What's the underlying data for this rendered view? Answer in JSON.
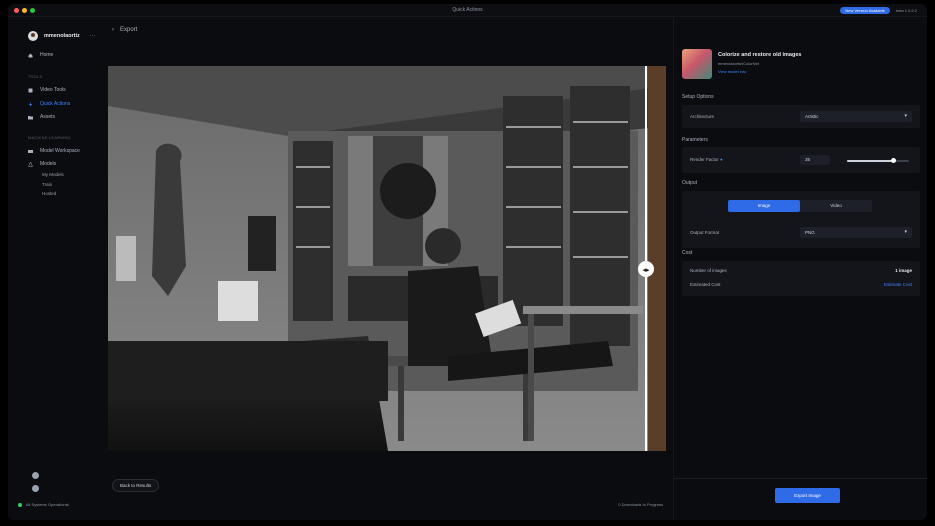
{
  "window": {
    "title": "Quick Actions",
    "badge": "New Version Available",
    "version": "beta 1.0.9.2"
  },
  "user": {
    "name": "mmenolaortiz",
    "more": "···"
  },
  "sidebar": {
    "home": "Home",
    "tools_section": "TOOLS",
    "video_tools": "Video Tools",
    "quick_actions": "Quick Actions",
    "assets": "Assets",
    "ml_section": "MACHINE LEARNING",
    "model_workspace": "Model Workspace",
    "models": "Models",
    "my_models": "My Models",
    "train": "Train",
    "hosted": "Hosted",
    "status": "All Systems Operational"
  },
  "main": {
    "back_label": "Export",
    "back_to_results": "Back to Results",
    "downloads": "0 Downloads In Progress"
  },
  "panel": {
    "title": "Colorize and restore old images",
    "author": "mmenolaortiz/ColorNet",
    "link": "View model info",
    "setup_label": "Setup Options",
    "architecture_label": "Architecture",
    "architecture_value": "Artistic",
    "parameters_label": "Parameters",
    "render_factor_label": "Render Factor",
    "render_factor_value": "35",
    "render_factor_level": 0.75,
    "output_label": "Output",
    "image_tab": "Image",
    "video_tab": "Video",
    "output_format_label": "Output Format",
    "output_format_value": "PNG",
    "cost_label": "Cost",
    "num_images_label": "Number of images",
    "num_images_value": "1 image",
    "estimated_cost_label": "Estimated Cost",
    "estimated_cost_value": "Estimate Cost",
    "export_button": "Export Image"
  },
  "colors": {
    "accent": "#2f6be6",
    "status_green": "#2fd06a"
  }
}
